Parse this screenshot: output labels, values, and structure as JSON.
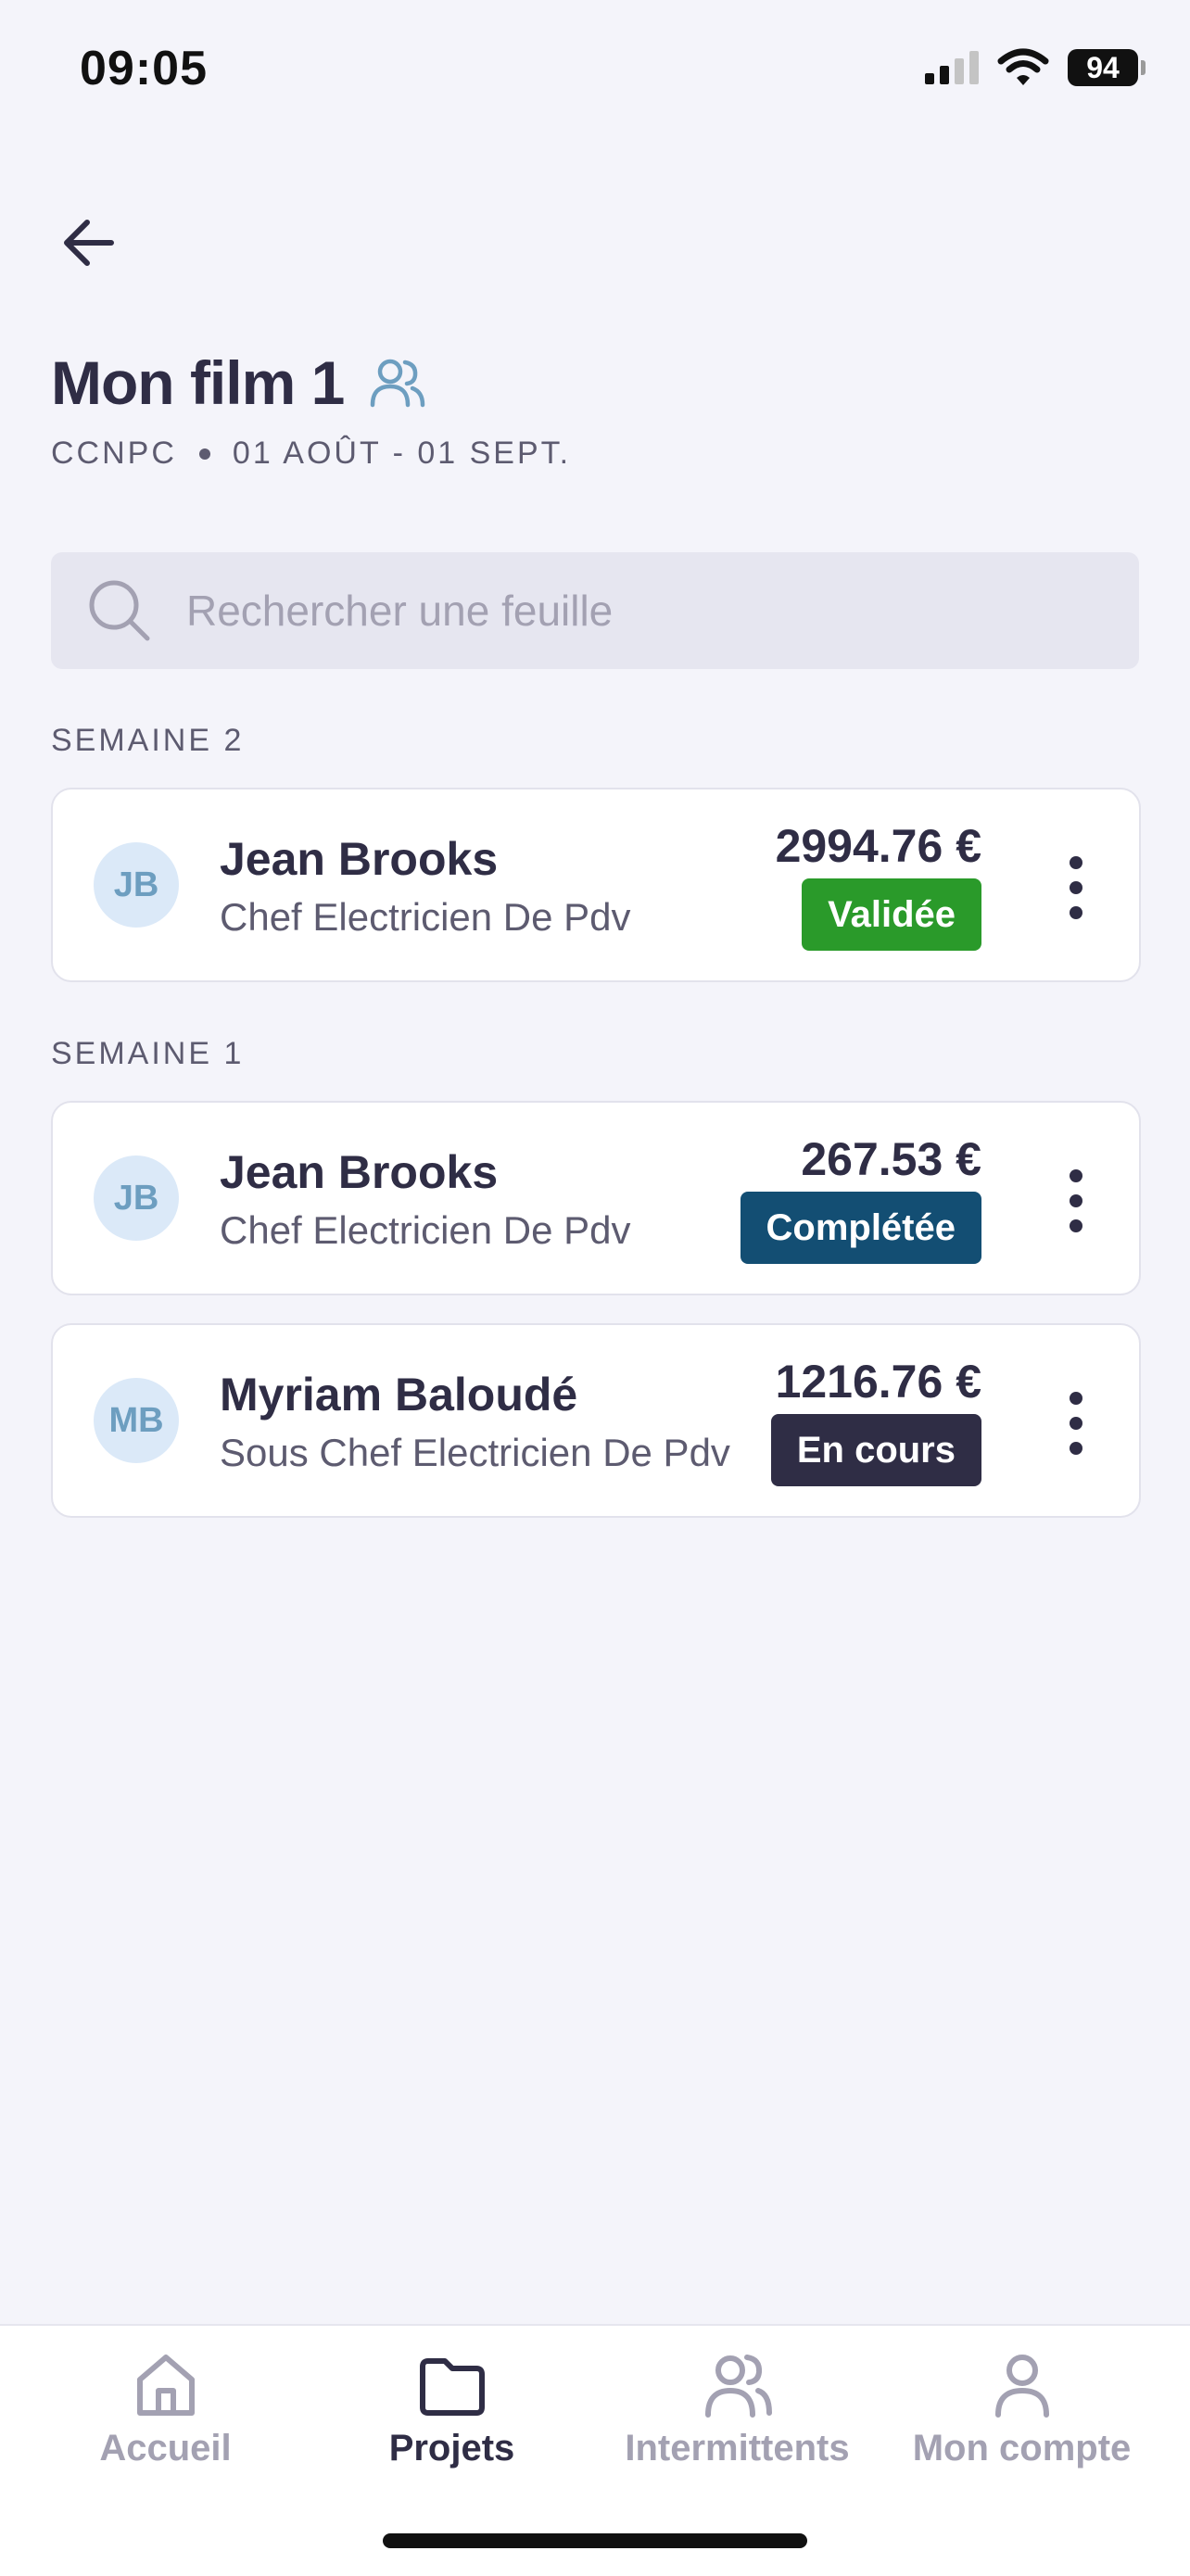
{
  "status_bar": {
    "time": "09:05",
    "battery": "94"
  },
  "header": {
    "title": "Mon film 1",
    "convention": "CCNPC",
    "dates": "01 AOÛT - 01 SEPT."
  },
  "search": {
    "placeholder": "Rechercher une feuille",
    "value": ""
  },
  "sections": [
    {
      "label": "SEMAINE 2",
      "items": [
        {
          "initials": "JB",
          "name": "Jean Brooks",
          "role": "Chef Electricien De Pdv",
          "amount": "2994.76 €",
          "status": "Validée",
          "status_color": "#2a9a2a"
        }
      ]
    },
    {
      "label": "SEMAINE 1",
      "items": [
        {
          "initials": "JB",
          "name": "Jean Brooks",
          "role": "Chef Electricien De Pdv",
          "amount": "267.53 €",
          "status": "Complétée",
          "status_color": "#134e73"
        },
        {
          "initials": "MB",
          "name": "Myriam Baloudé",
          "role": "Sous Chef Electricien De Pdv",
          "amount": "1216.76 €",
          "status": "En cours",
          "status_color": "#2f2d45"
        }
      ]
    }
  ],
  "tab_bar": {
    "tabs": [
      {
        "label": "Accueil",
        "icon": "home-icon",
        "active": false
      },
      {
        "label": "Projets",
        "icon": "folder-icon",
        "active": true
      },
      {
        "label": "Intermittents",
        "icon": "users-icon",
        "active": false
      },
      {
        "label": "Mon compte",
        "icon": "user-icon",
        "active": false
      }
    ]
  },
  "colors": {
    "background": "#f4f4fa",
    "text_primary": "#2f2d45",
    "accent_icon": "#6d9ec0",
    "tab_inactive": "#a3a1b2"
  }
}
